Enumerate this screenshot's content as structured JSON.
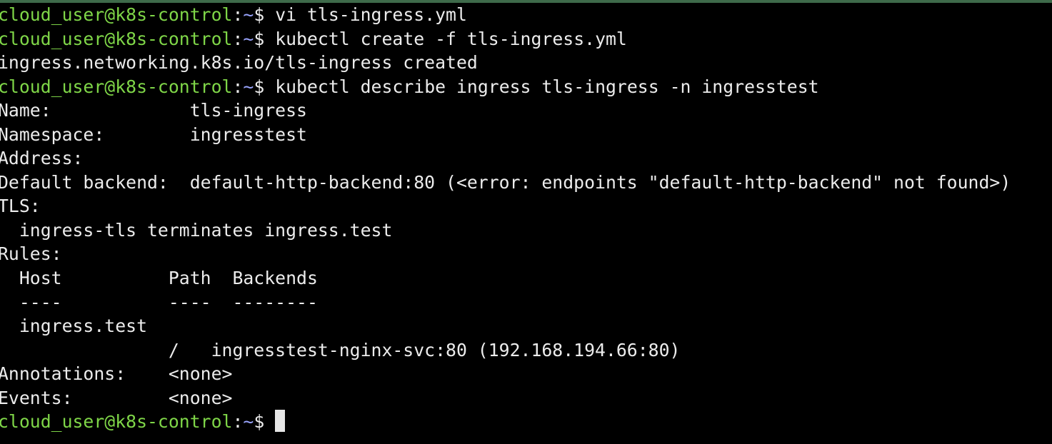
{
  "terminal": {
    "colors": {
      "background": "#000000",
      "text": "#ececec",
      "prompt_user": "#7fd648",
      "prompt_path": "#9aa5ff"
    },
    "prompt": {
      "user_host": "cloud_user@k8s-control",
      "sep": ":",
      "path": "~",
      "symbol": "$"
    },
    "commands": [
      " vi tls-ingress.yml",
      " kubectl create -f tls-ingress.yml",
      " kubectl describe ingress tls-ingress -n ingresstest"
    ],
    "output": {
      "create_result": "ingress.networking.k8s.io/tls-ingress created",
      "describe": [
        "Name:             tls-ingress",
        "Namespace:        ingresstest",
        "Address:",
        "Default backend:  default-http-backend:80 (<error: endpoints \"default-http-backend\" not found>)",
        "TLS:",
        "  ingress-tls terminates ingress.test",
        "Rules:",
        "  Host          Path  Backends",
        "  ----          ----  --------",
        "  ingress.test",
        "                /   ingresstest-nginx-svc:80 (192.168.194.66:80)",
        "Annotations:    <none>",
        "Events:         <none>"
      ]
    }
  }
}
